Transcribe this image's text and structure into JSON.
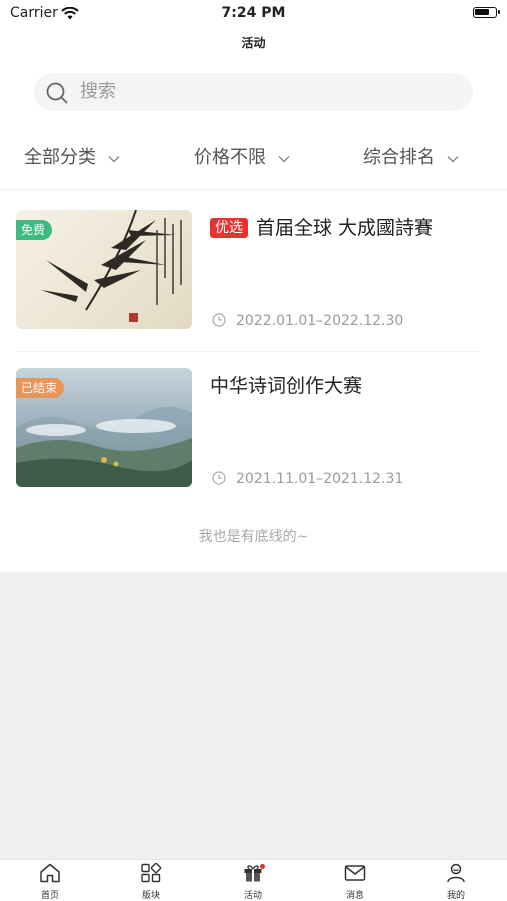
{
  "status_bar": {
    "carrier": "Carrier",
    "time": "7:24 PM"
  },
  "header": {
    "title": "活动"
  },
  "search": {
    "placeholder": "搜索"
  },
  "filters": [
    {
      "label": "全部分类"
    },
    {
      "label": "价格不限"
    },
    {
      "label": "综合排名"
    }
  ],
  "activities": [
    {
      "tag": "免费",
      "tag_color": "#3fba80",
      "badge": "优选",
      "title": "首届全球 大成國詩賽",
      "date": "2022.01.01–2022.12.30"
    },
    {
      "tag": "已结束",
      "tag_color": "#e8955a",
      "badge": "",
      "title": "中华诗词创作大赛",
      "date": "2021.11.01–2021.12.31"
    }
  ],
  "list_end_text": "我也是有底线的~",
  "tabbar": {
    "items": [
      {
        "label": "首页",
        "icon": "home-icon"
      },
      {
        "label": "版块",
        "icon": "grid-icon"
      },
      {
        "label": "活动",
        "icon": "gift-icon",
        "active": true
      },
      {
        "label": "消息",
        "icon": "mail-icon"
      },
      {
        "label": "我的",
        "icon": "person-icon"
      }
    ]
  }
}
